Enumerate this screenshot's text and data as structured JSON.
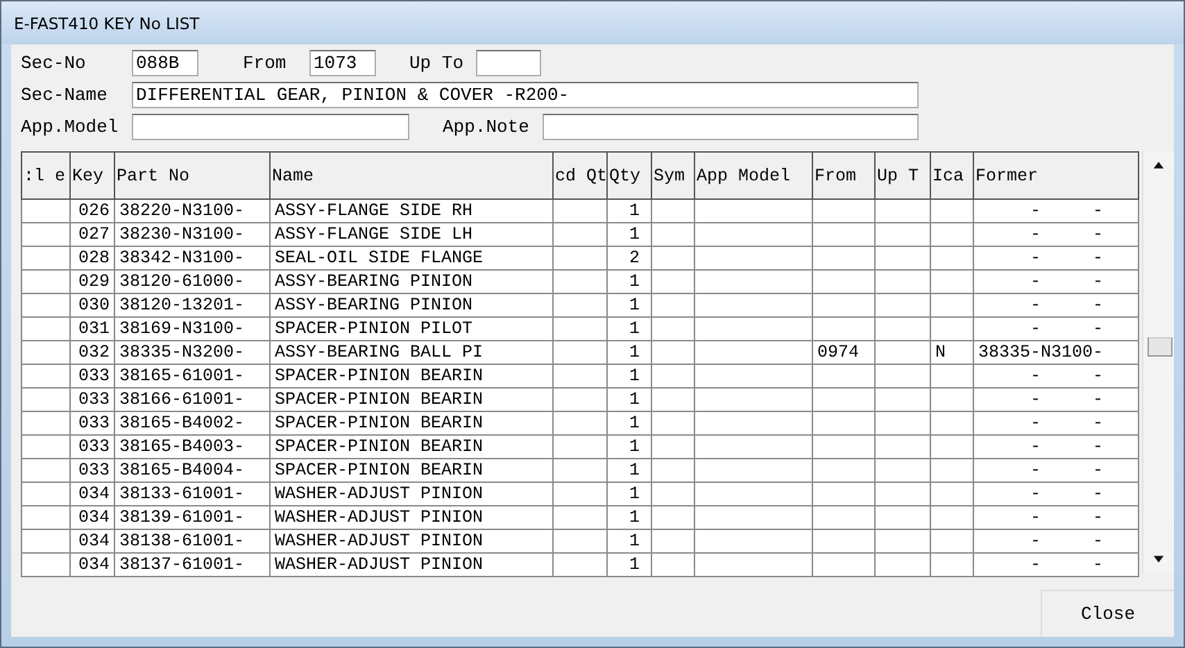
{
  "window": {
    "title": "E-FAST410 KEY No LIST"
  },
  "form": {
    "sec_no": {
      "label": "Sec-No",
      "value": "088B"
    },
    "from": {
      "label": "From",
      "value": "1073"
    },
    "up_to": {
      "label": "Up To"
    },
    "sec_name": {
      "label": "Sec-Name",
      "value": "DIFFERENTIAL GEAR, PINION & COVER -R200-"
    },
    "app_model": {
      "label": "App.Model"
    },
    "app_note": {
      "label": "App.Note"
    }
  },
  "table": {
    "columns": [
      ":l e",
      "Key",
      "Part No",
      "Name",
      "cd Qt",
      "Qty",
      "Sym",
      "App Model",
      "From",
      "Up T",
      "Ica",
      "Former"
    ],
    "rows": [
      {
        "key": "026",
        "part_no": "38220-N3100-",
        "name": "ASSY-FLANGE SIDE RH",
        "qty": "1",
        "former": "     -     -"
      },
      {
        "key": "027",
        "part_no": "38230-N3100-",
        "name": "ASSY-FLANGE SIDE LH",
        "qty": "1",
        "former": "     -     -"
      },
      {
        "key": "028",
        "part_no": "38342-N3100-",
        "name": "SEAL-OIL SIDE FLANGE",
        "qty": "2",
        "former": "     -     -"
      },
      {
        "key": "029",
        "part_no": "38120-61000-",
        "name": "ASSY-BEARING PINION",
        "qty": "1",
        "former": "     -     -"
      },
      {
        "key": "030",
        "part_no": "38120-13201-",
        "name": "ASSY-BEARING PINION",
        "qty": "1",
        "former": "     -     -"
      },
      {
        "key": "031",
        "part_no": "38169-N3100-",
        "name": "SPACER-PINION PILOT",
        "qty": "1",
        "former": "     -     -"
      },
      {
        "key": "032",
        "part_no": "38335-N3200-",
        "name": "ASSY-BEARING BALL PI",
        "qty": "1",
        "from": "0974",
        "ica": "N",
        "former": "38335-N3100-"
      },
      {
        "key": "033",
        "part_no": "38165-61001-",
        "name": "SPACER-PINION BEARIN",
        "qty": "1",
        "former": "     -     -"
      },
      {
        "key": "033",
        "part_no": "38166-61001-",
        "name": "SPACER-PINION BEARIN",
        "qty": "1",
        "former": "     -     -"
      },
      {
        "key": "033",
        "part_no": "38165-B4002-",
        "name": "SPACER-PINION BEARIN",
        "qty": "1",
        "former": "     -     -"
      },
      {
        "key": "033",
        "part_no": "38165-B4003-",
        "name": "SPACER-PINION BEARIN",
        "qty": "1",
        "former": "     -     -"
      },
      {
        "key": "033",
        "part_no": "38165-B4004-",
        "name": "SPACER-PINION BEARIN",
        "qty": "1",
        "former": "     -     -"
      },
      {
        "key": "034",
        "part_no": "38133-61001-",
        "name": "WASHER-ADJUST PINION",
        "qty": "1",
        "former": "     -     -"
      },
      {
        "key": "034",
        "part_no": "38139-61001-",
        "name": "WASHER-ADJUST PINION",
        "qty": "1",
        "former": "     -     -"
      },
      {
        "key": "034",
        "part_no": "38138-61001-",
        "name": "WASHER-ADJUST PINION",
        "qty": "1",
        "former": "     -     -"
      },
      {
        "key": "034",
        "part_no": "38137-61001-",
        "name": "WASHER-ADJUST PINION",
        "qty": "1",
        "former": "     -     -"
      }
    ]
  },
  "buttons": [
    "Close"
  ]
}
